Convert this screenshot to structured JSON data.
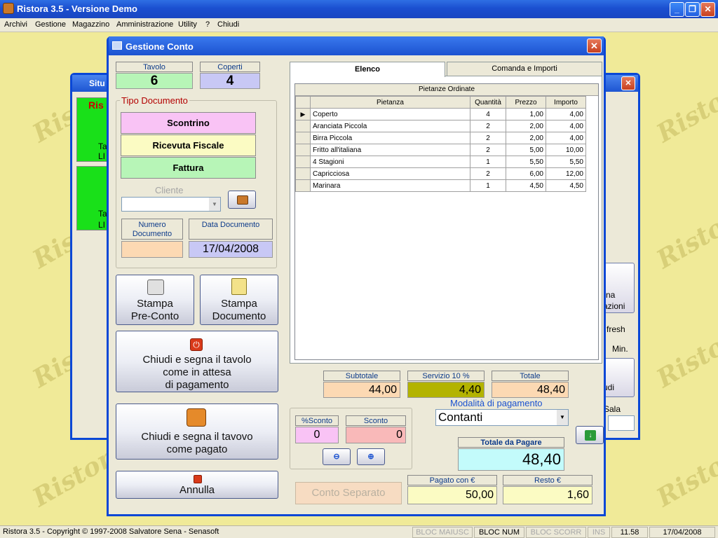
{
  "window": {
    "title": "Ristora 3.5 - Versione Demo"
  },
  "menu": [
    "Archivi",
    "Gestione",
    "Magazzino",
    "Amministrazione",
    "Utility",
    "?",
    "Chiudi"
  ],
  "watermark": "Ristora",
  "background_window": {
    "title": "Situ",
    "tile_title": "Ris",
    "tile1_a": "Ta",
    "tile1_b": "LI",
    "tile2_a": "Ta",
    "tile2_b": "LI",
    "btn1_a": "rna",
    "btn1_b": "azioni",
    "refresh": "fresh",
    "min": "Min.",
    "btn2": "udi",
    "sala": "Sala"
  },
  "dialog": {
    "title": "Gestione Conto",
    "tavolo_label": "Tavolo",
    "tavolo_value": "6",
    "coperti_label": "Coperti",
    "coperti_value": "4",
    "tipo_documento_label": "Tipo Documento",
    "scontrino": "Scontrino",
    "ricevuta": "Ricevuta Fiscale",
    "fattura": "Fattura",
    "cliente_label": "Cliente",
    "numero_documento_label": "Numero Documento",
    "numero_documento_value": "",
    "data_documento_label": "Data Documento",
    "data_documento_value": "17/04/2008",
    "stampa_preconto": [
      "Stampa",
      "Pre-Conto"
    ],
    "stampa_documento": [
      "Stampa",
      "Documento"
    ],
    "chiudi_attesa": [
      "Chiudi e segna il tavolo",
      "come in attesa",
      "di pagamento"
    ],
    "chiudi_pagato": [
      "Chiudi e segna il tavovo",
      "come pagato"
    ],
    "annulla": "Annulla",
    "tabs": [
      "Elenco",
      "Comanda e Importi"
    ],
    "grid_title": "Pietanze Ordinate",
    "columns": [
      "Pietanza",
      "Quantità",
      "Prezzo",
      "Importo"
    ],
    "rows": [
      [
        "Coperto",
        "4",
        "1,00",
        "4,00"
      ],
      [
        "Aranciata Piccola",
        "2",
        "2,00",
        "4,00"
      ],
      [
        "Birra Piccola",
        "2",
        "2,00",
        "4,00"
      ],
      [
        "Fritto all'italiana",
        "2",
        "5,00",
        "10,00"
      ],
      [
        "4 Stagioni",
        "1",
        "5,50",
        "5,50"
      ],
      [
        "Capricciosa",
        "2",
        "6,00",
        "12,00"
      ],
      [
        "Marinara",
        "1",
        "4,50",
        "4,50"
      ]
    ],
    "subtotale_label": "Subtotale",
    "subtotale_value": "44,00",
    "servizio_label": "Servizio 10 %",
    "servizio_value": "4,40",
    "totale_label": "Totale",
    "totale_value": "48,40",
    "percent_sconto_label": "%Sconto",
    "percent_sconto_value": "0",
    "sconto_label": "Sconto",
    "sconto_value": "0",
    "modalita_label": "Modalità di pagamento",
    "modalita_value": "Contanti",
    "totale_pagare_label": "Totale da Pagare",
    "totale_pagare_value": "48,40",
    "conto_separato": "Conto Separato",
    "pagato_label": "Pagato con €",
    "pagato_value": "50,00",
    "resto_label": "Resto €",
    "resto_value": "1,60"
  },
  "status": {
    "copyright": "Ristora 3.5 - Copyright © 1997-2008 Salvatore Sena - Senasoft",
    "caps": "BLOC MAIUSC",
    "num": "BLOC NUM",
    "scroll": "BLOC SCORR",
    "ins": "INS",
    "time": "11.58",
    "date": "17/04/2008"
  },
  "colors": {
    "title_blue": "#1b52d0",
    "tavolo_bg": "#b7f5b7",
    "coperti_bg": "#c8c8f5",
    "scontrino_bg": "#f9c3f5",
    "ricevuta_bg": "#fbfbc3",
    "fattura_bg": "#b7f5b7",
    "subtotale_bg": "#fcd9b3",
    "servizio_bg": "#b3b300",
    "totale_bg": "#fcd9b3",
    "perc_sconto_bg": "#f9c3f5",
    "sconto_bg": "#f9b9b9",
    "totale_pagare_bg": "#c3fbfb",
    "pagato_bg": "#fbfbc3",
    "resto_bg": "#fbfbc3"
  }
}
